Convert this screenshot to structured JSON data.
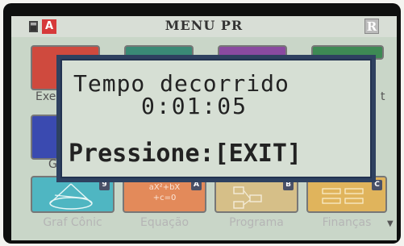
{
  "status_bar": {
    "battery_icon": "battery-icon",
    "mode_badge": "A",
    "menu_title": "MENU PR",
    "r_badge": "R"
  },
  "menu_tiles": [
    {
      "label": "Graf Cônic",
      "number": "9",
      "color": "#4fb6c2",
      "icon": "cone-icon"
    },
    {
      "label": "Equação",
      "number": "A",
      "color": "#e38a5a",
      "icon": "equation-icon",
      "icon_text": "aX²+bX\n+c=0"
    },
    {
      "label": "Programa",
      "number": "B",
      "color": "#d6bf88",
      "icon": "program-icon"
    },
    {
      "label": "Finanças",
      "number": "C",
      "color": "#e0b45c",
      "icon": "finance-icon"
    }
  ],
  "partial_labels": {
    "exe": "Exe",
    "g": "G"
  },
  "popup": {
    "line1": "Tempo decorrido",
    "time": "0:01:05",
    "prompt": "Pressione:[EXIT]"
  },
  "colors": {
    "popup_border": "#2e4160",
    "popup_bg": "#d6dfd4",
    "screen_bg": "#c9d6c8"
  }
}
